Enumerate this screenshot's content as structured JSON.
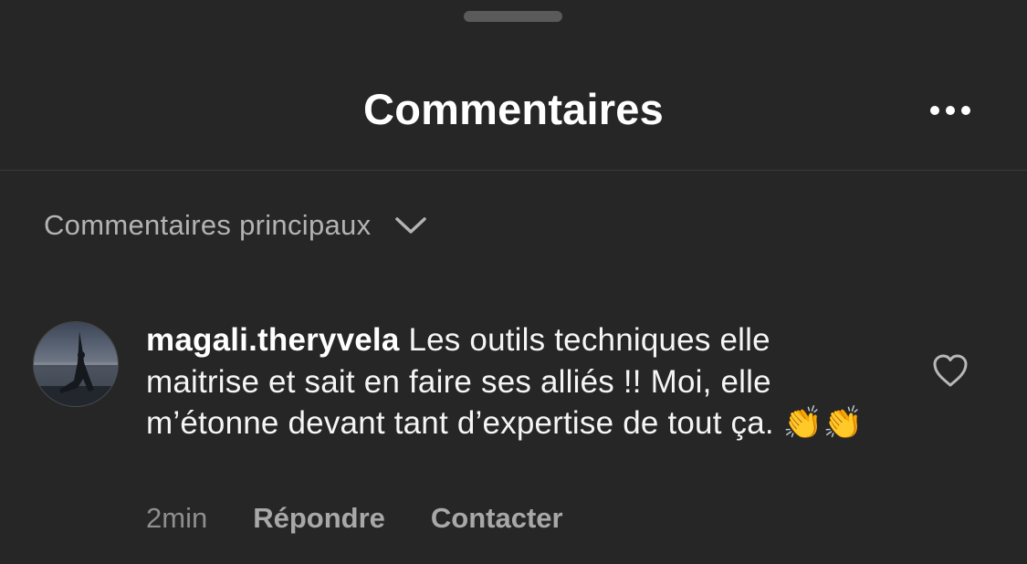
{
  "sheet": {
    "title": "Commentaires",
    "more_icon": "more-horizontal-icon"
  },
  "filter": {
    "label": "Commentaires principaux",
    "icon": "chevron-down-icon"
  },
  "comments": [
    {
      "username": "magali.theryvela",
      "text": "Les outils techniques elle maitrise et sait en faire ses alliés !! Moi, elle m’étonne devant tant d’expertise de tout ça. 👏👏",
      "time": "2min",
      "reply_label": "Répondre",
      "contact_label": "Contacter",
      "like_icon": "heart-outline-icon",
      "avatar_icon": "avatar-photo"
    }
  ],
  "colors": {
    "background": "#262626",
    "primary_text": "#f5f5f5",
    "secondary_text": "#a8a8a8",
    "divider": "#3a3a3a"
  }
}
